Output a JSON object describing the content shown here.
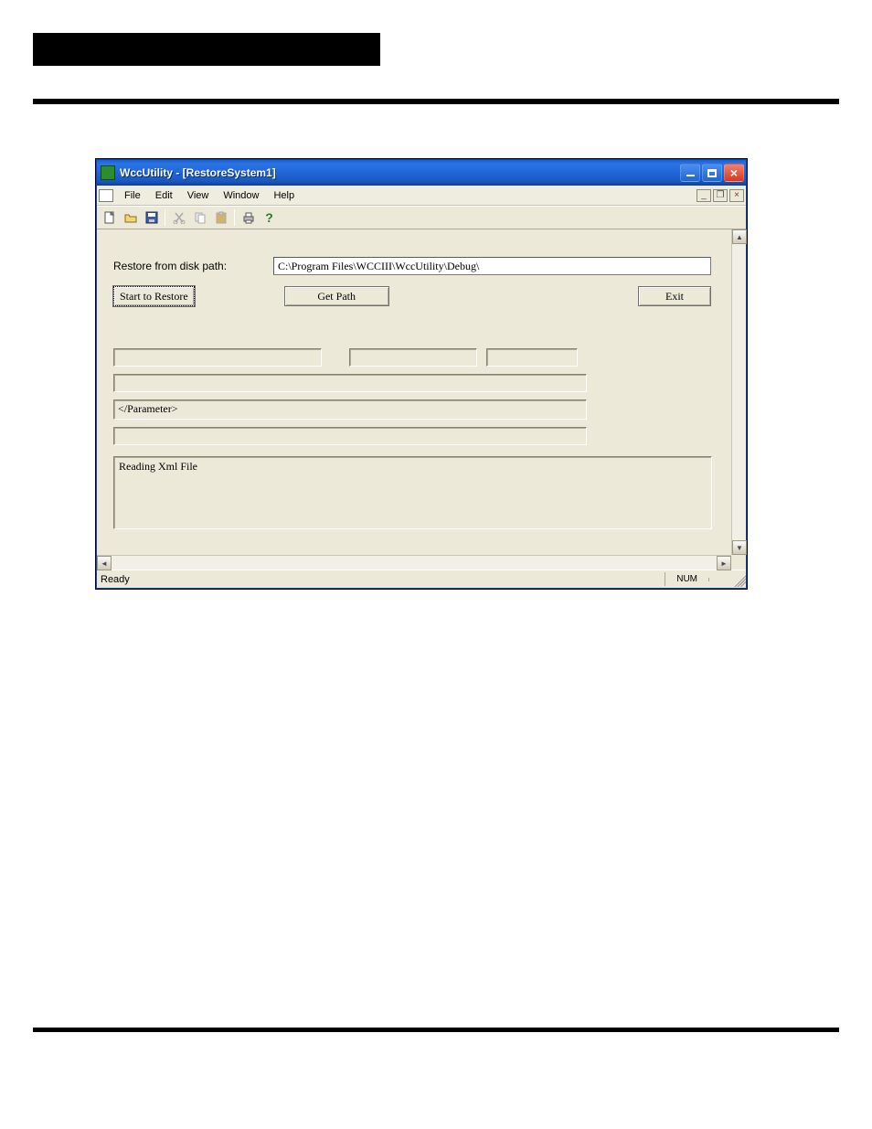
{
  "window": {
    "title": "WccUtility - [RestoreSystem1]"
  },
  "menubar": {
    "items": [
      "File",
      "Edit",
      "View",
      "Window",
      "Help"
    ]
  },
  "toolbar": {
    "icons": {
      "new": "new-file-icon",
      "open": "open-folder-icon",
      "save": "save-disk-icon",
      "cut": "cut-icon",
      "copy": "copy-icon",
      "paste": "paste-icon",
      "print": "print-icon",
      "help": "help-icon"
    }
  },
  "form": {
    "path_label": "Restore from disk path:",
    "path_value": "C:\\Program Files\\WCCIII\\WccUtility\\Debug\\",
    "start_button": "Start to Restore",
    "getpath_button": "Get Path",
    "exit_button": "Exit",
    "param_text": "</Parameter>",
    "log_text": "Reading Xml File"
  },
  "statusbar": {
    "ready": "Ready",
    "num": "NUM"
  }
}
